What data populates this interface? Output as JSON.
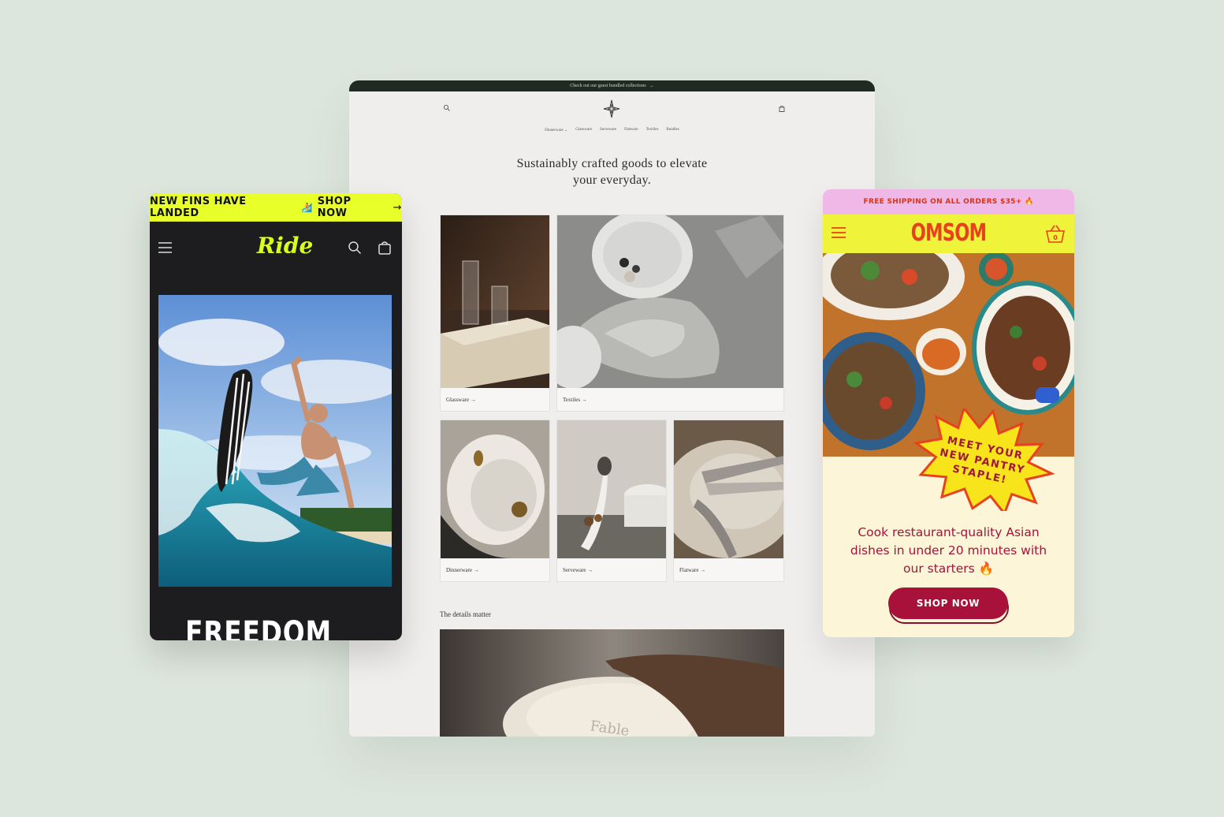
{
  "fable": {
    "announcement": "Check out our guest bundled collections",
    "announcement_arrow": "→",
    "nav": [
      "Dinnerware ⌄",
      "Glassware",
      "Serveware",
      "Flatware",
      "Textiles",
      "Bundles"
    ],
    "hero_line1": "Sustainably crafted goods to elevate",
    "hero_line2": "your everyday.",
    "collections": {
      "glassware": "Glassware →",
      "textiles": "Textiles →",
      "dinnerware": "Dinnerware →",
      "serveware": "Serveware →",
      "flatware": "Flatware →"
    },
    "details_heading": "The details matter",
    "plate_text": "Fable"
  },
  "ride": {
    "banner_left": "NEW FINS HAVE LANDED",
    "banner_emoji": "🏄",
    "banner_right": "SHOP NOW",
    "banner_arrow": "→",
    "logo": "Ride",
    "headline": "FREEDOM"
  },
  "omsom": {
    "banner": "FREE SHIPPING ON ALL ORDERS $35+ 🔥",
    "logo": "OMSOM",
    "cart_count": "0",
    "star_line1": "MEET YOUR",
    "star_line2": "NEW PANTRY",
    "star_line3": "STAPLE!",
    "tagline": "Cook restaurant-quality Asian dishes in under 20 minutes with our starters 🔥",
    "cta": "SHOP NOW"
  },
  "colors": {
    "page_bg": "#dde6dd",
    "ride_accent": "#e8ff2a",
    "omsom_red": "#e8411e",
    "omsom_cta": "#a8123a",
    "omsom_yellow": "#eff33a",
    "omsom_pink": "#efb8e6"
  },
  "icons": [
    "search-icon",
    "cart-icon",
    "menu-icon",
    "star-logo-icon",
    "basket-icon",
    "arrow-right-icon"
  ]
}
